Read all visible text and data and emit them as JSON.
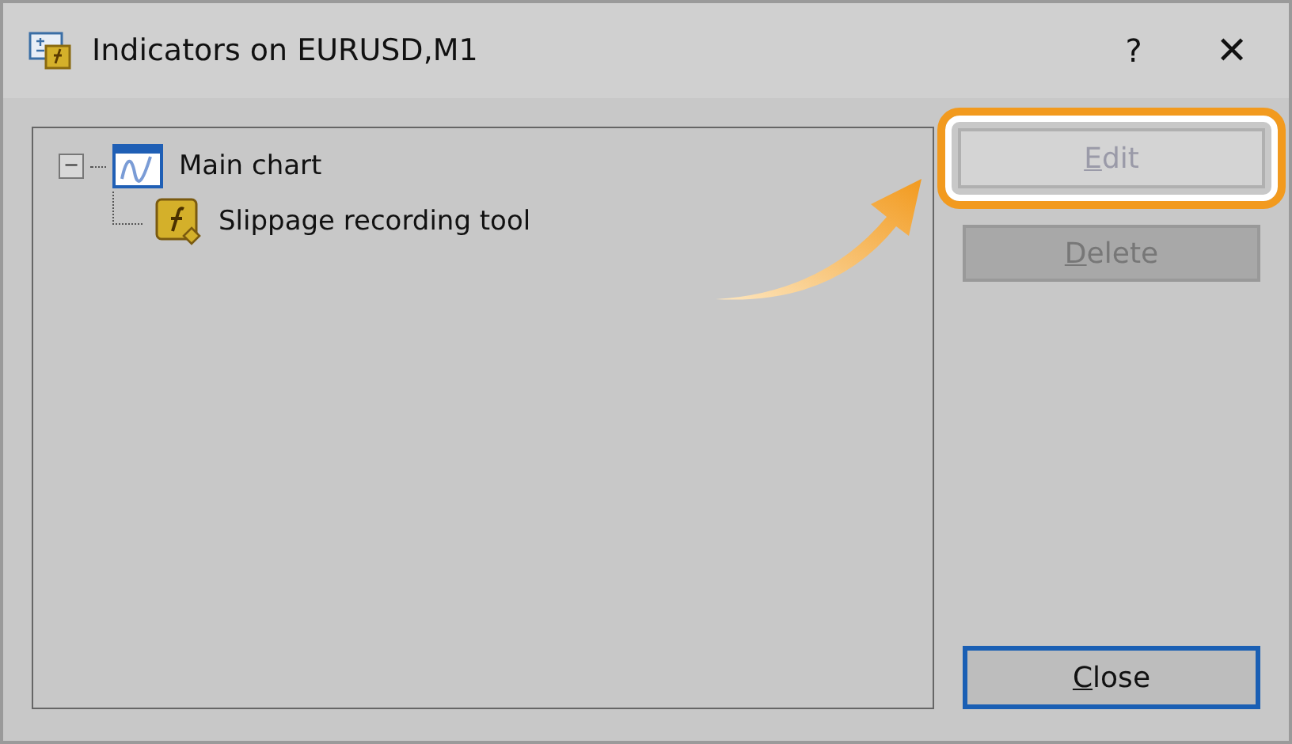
{
  "window": {
    "title": "Indicators on EURUSD,M1",
    "help": "?",
    "close": "✕"
  },
  "tree": [
    {
      "label": "Main chart",
      "kind": "chart",
      "expanded": true,
      "expander": "−",
      "children": [
        {
          "label": "Slippage recording tool",
          "kind": "indicator"
        }
      ]
    }
  ],
  "buttons": [
    {
      "access_key": "E",
      "label_rest": "dit",
      "kind": "action",
      "disabled": true,
      "highlighted": true,
      "default": false
    },
    {
      "access_key": "D",
      "label_rest": "elete",
      "kind": "action",
      "disabled": true,
      "highlighted": false,
      "default": false
    },
    {
      "access_key": "C",
      "label_rest": "lose",
      "kind": "footer",
      "disabled": false,
      "highlighted": false,
      "default": true
    }
  ]
}
